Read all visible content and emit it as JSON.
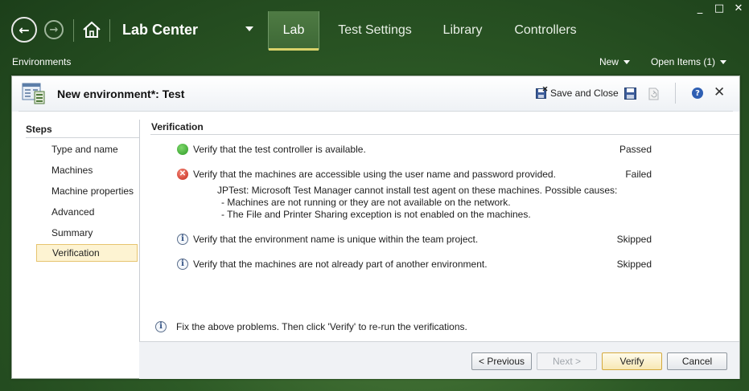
{
  "window": {
    "minimize": "_",
    "maximize": "□",
    "close": "✕"
  },
  "nav": {
    "app_title": "Lab Center",
    "tabs": [
      {
        "label": "Lab",
        "active": true
      },
      {
        "label": "Test Settings",
        "active": false
      },
      {
        "label": "Library",
        "active": false
      },
      {
        "label": "Controllers",
        "active": false
      }
    ],
    "accent_color": "#d8d26a"
  },
  "subbar": {
    "section": "Environments",
    "new_label": "New",
    "open_items_label": "Open Items (1)"
  },
  "dialog": {
    "title": "New environment*: Test",
    "save_close_label": "Save and Close",
    "help_glyph": "?",
    "steps_title": "Steps",
    "steps": [
      {
        "label": "Type and name"
      },
      {
        "label": "Machines"
      },
      {
        "label": "Machine properties"
      },
      {
        "label": "Advanced"
      },
      {
        "label": "Summary"
      },
      {
        "label": "Verification",
        "selected": true
      }
    ],
    "content_title": "Verification",
    "verifications": [
      {
        "icon": "pass",
        "text": "Verify that the test controller is available.",
        "status": "Passed"
      },
      {
        "icon": "fail",
        "text": "Verify that the machines are accessible using the user name and password provided.",
        "status": "Failed"
      },
      {
        "icon": "info",
        "text": "Verify that the environment name is unique within the team project.",
        "status": "Skipped"
      },
      {
        "icon": "info",
        "text": "Verify that the machines are not already part of another environment.",
        "status": "Skipped"
      }
    ],
    "failure_detail": {
      "line1": "JPTest: Microsoft Test Manager cannot install test agent on these machines. Possible causes:",
      "line2": "- Machines are not running or they are not available on the network.",
      "line3": "- The File and Printer Sharing exception is not enabled on the machines."
    },
    "footer_note": "Fix the above problems. Then click 'Verify' to re-run the verifications.",
    "buttons": {
      "previous": "< Previous",
      "next": "Next >",
      "verify": "Verify",
      "cancel": "Cancel"
    }
  }
}
